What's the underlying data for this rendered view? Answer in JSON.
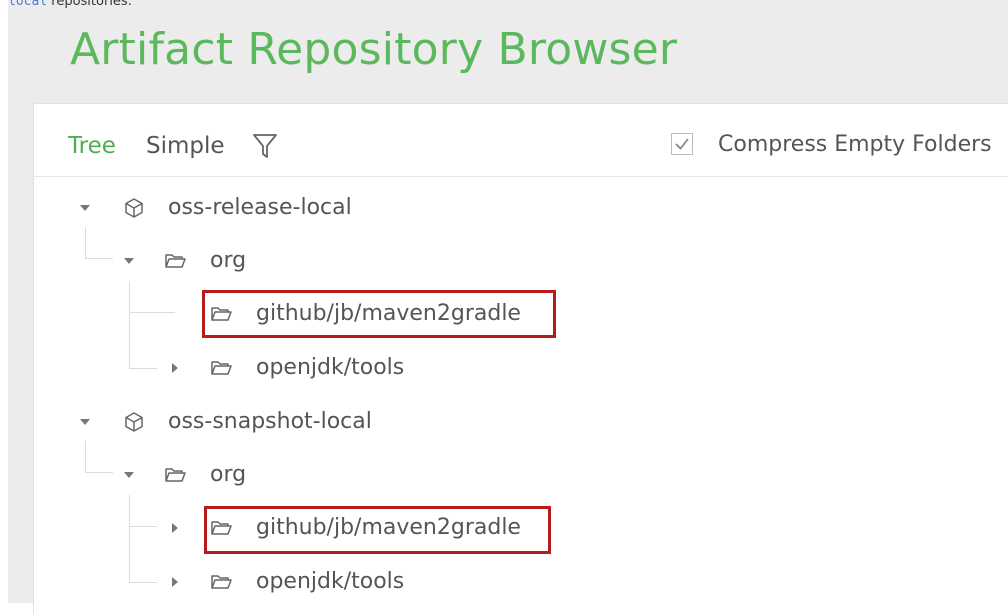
{
  "snippet": {
    "code": "local",
    "text": " repositories."
  },
  "page": {
    "title": "Artifact Repository Browser"
  },
  "tabs": {
    "tree_label": "Tree",
    "simple_label": "Simple",
    "filter_icon": "filter-icon"
  },
  "options": {
    "compress_label": "Compress Empty Folders",
    "compress_checked": true
  },
  "colors": {
    "title": "#5cb85c",
    "active_tab": "#4caf50",
    "highlight": "#b71c1c",
    "text": "#555555"
  },
  "tree": {
    "repo1": {
      "label": "oss-release-local",
      "org": {
        "label": "org",
        "child1": "github/jb/maven2gradle",
        "child2": "openjdk/tools"
      }
    },
    "repo2": {
      "label": "oss-snapshot-local",
      "org": {
        "label": "org",
        "child1": "github/jb/maven2gradle",
        "child2": "openjdk/tools"
      }
    }
  }
}
